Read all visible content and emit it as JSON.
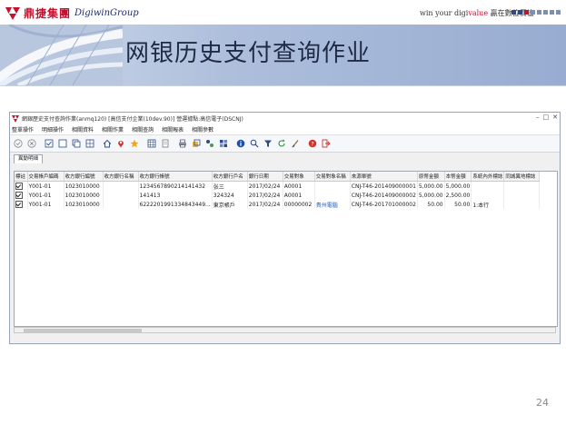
{
  "brand": {
    "logo_cn": "鼎捷集團",
    "logo_en": "DigiwinGroup",
    "slogan_prefix": "win your digi",
    "slogan_accent": "value",
    "slogan_suffix": " 贏在數位價值",
    "brand_color": "#c8102e",
    "square_colors": [
      "#2b4a8a",
      "#2b4a8a",
      "#c8102e",
      "#7a8fb5",
      "#7a8fb5",
      "#7a8fb5",
      "#7a8fb5",
      "#7a8fb5"
    ]
  },
  "slide": {
    "title": "网银历史支付查询作业",
    "page_number": "24"
  },
  "window": {
    "title": "網銀歷史支付查詢作業(anmq120) [高信支付企業(10dev.90)] 營運據點:高信電子(DSCNJ)",
    "menu": [
      "整單操作",
      "明細操作",
      "相關資料",
      "相關作業",
      "相關查詢",
      "相關報表",
      "相關參數"
    ],
    "toolbar_icons": [
      "confirm-icon",
      "cancel-icon",
      "select-all-icon",
      "deselect-icon",
      "copy-icon",
      "multi-window-icon",
      "home-icon",
      "location-pin-icon",
      "favorite-star-icon",
      "grid-icon",
      "export-icon",
      "print-icon",
      "attachment-icon",
      "tools-icon",
      "refresh-grid-icon",
      "info-icon",
      "search-icon",
      "filter-icon",
      "reload-icon",
      "clear-icon",
      "help-icon",
      "exit-icon"
    ],
    "tab_label": "異動明細",
    "columns": [
      "標註",
      "交易帳戶編碼",
      "收方銀行編號",
      "收方銀行名稱",
      "收方銀行帳號",
      "收方銀行戶名",
      "銀行日期",
      "交易對象",
      "交易對象名稱",
      "來源單號",
      "原幣金額",
      "本幣金額",
      "系統內外標誌",
      "同城異地標誌"
    ],
    "rows": [
      {
        "account": "Y001-01",
        "bank_no": "1023010000",
        "bank_name": "",
        "bank_account": "1234567890214141432",
        "account_name": "张三",
        "date": "2017/02/24",
        "party": "A0001",
        "party_name": "",
        "source_no": "CNJ-T46-201409000001",
        "orig_amt": "5,000.00",
        "local_amt": "5,000.00",
        "sys_flag": "",
        "city_flag": ""
      },
      {
        "account": "Y001-01",
        "bank_no": "1023010000",
        "bank_name": "",
        "bank_account": "141413",
        "account_name": "324324",
        "date": "2017/02/24",
        "party": "A0001",
        "party_name": "",
        "source_no": "CNJ-T46-201409000002",
        "orig_amt": "5,000.00",
        "local_amt": "2,500.00",
        "sys_flag": "",
        "city_flag": ""
      },
      {
        "account": "Y001-01",
        "bank_no": "1023010000",
        "bank_name": "",
        "bank_account": "6222201991334843449...",
        "account_name": "東京帳戶",
        "date": "2017/02/24",
        "party": "00000002",
        "party_name": "貴州電腦",
        "source_no": "CNJ-T46-201701000002",
        "orig_amt": "50.00",
        "local_amt": "50.00",
        "sys_flag": "1:本行",
        "city_flag": ""
      }
    ]
  }
}
